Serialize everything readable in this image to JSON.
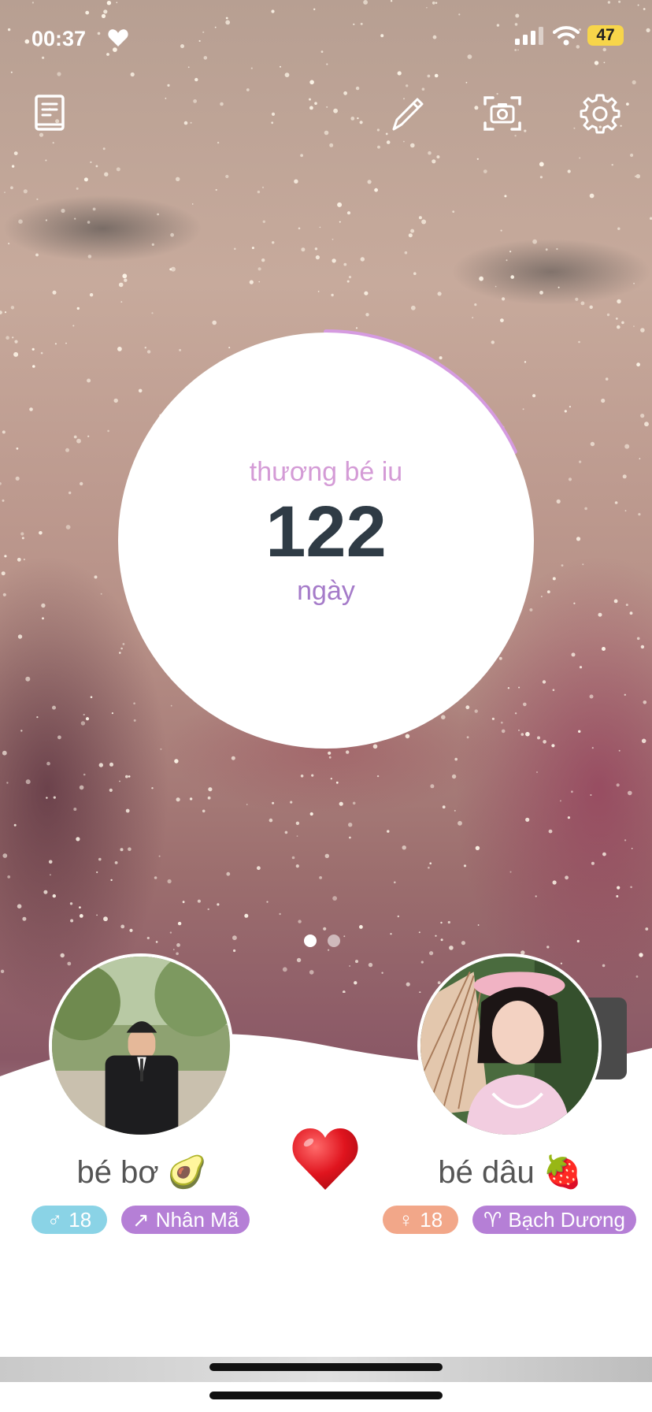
{
  "status_bar": {
    "time": "00:37",
    "battery": "47",
    "battery_color": "#f7d54a"
  },
  "toolbar": {
    "icons": [
      "book-icon",
      "pencil-icon",
      "camera-icon",
      "gear-icon"
    ]
  },
  "counter": {
    "title": "thương bé iu",
    "days": "122",
    "unit": "ngày",
    "progress_percent": 18,
    "title_color": "#d49bd6",
    "unit_color": "#a57bc9",
    "ring_color": "#d59be0"
  },
  "pager": {
    "count": 2,
    "active_index": 0
  },
  "partner_left": {
    "name": "bé bơ 🥑",
    "gender_symbol": "♂",
    "age": "18",
    "zodiac_symbol": "↗",
    "zodiac": "Nhân Mã",
    "gender_color": "#8ad3e6"
  },
  "partner_right": {
    "name": "bé dâu 🍓",
    "gender_symbol": "♀",
    "age": "18",
    "zodiac_symbol": "♈",
    "zodiac": "Bạch Dương",
    "gender_color": "#f2a789"
  },
  "center_heart": "heart-icon",
  "zodiac_tag_color": "#b57fd6"
}
